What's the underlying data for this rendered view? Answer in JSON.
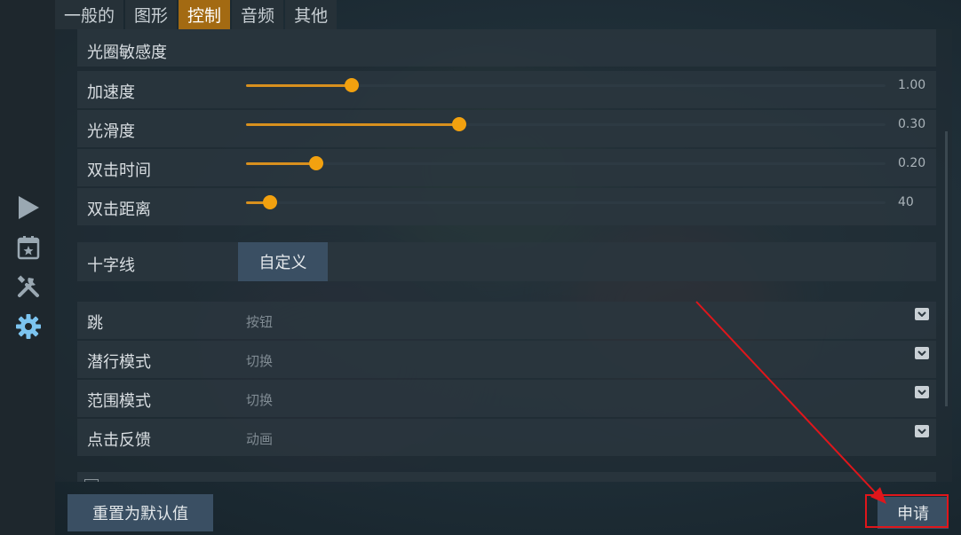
{
  "tabs": [
    {
      "label": "一般的",
      "active": false
    },
    {
      "label": "图形",
      "active": false
    },
    {
      "label": "控制",
      "active": true
    },
    {
      "label": "音频",
      "active": false
    },
    {
      "label": "其他",
      "active": false
    }
  ],
  "sidebar": {
    "icons": [
      "play-icon",
      "calendar-star-icon",
      "tools-icon",
      "gear-icon"
    ]
  },
  "partial_row_label": "光圈敏感度",
  "sliders": [
    {
      "label": "加速度",
      "value": "1.00",
      "fraction": 0.165
    },
    {
      "label": "光滑度",
      "value": "0.30",
      "fraction": 0.334
    },
    {
      "label": "双击时间",
      "value": "0.20",
      "fraction": 0.11
    },
    {
      "label": "双击距离",
      "value": "40",
      "fraction": 0.038
    }
  ],
  "crosshair": {
    "label": "十字线",
    "button": "自定义"
  },
  "dropdowns": [
    {
      "label": "跳",
      "value": "按钮"
    },
    {
      "label": "潜行模式",
      "value": "切换"
    },
    {
      "label": "范围模式",
      "value": "切换"
    },
    {
      "label": "点击反馈",
      "value": "动画"
    }
  ],
  "footer": {
    "reset_label": "重置为默认值",
    "apply_label": "申请"
  },
  "colors": {
    "accent": "#f2a10f",
    "tab_active": "#a36a12",
    "highlight": "#e0161b"
  }
}
